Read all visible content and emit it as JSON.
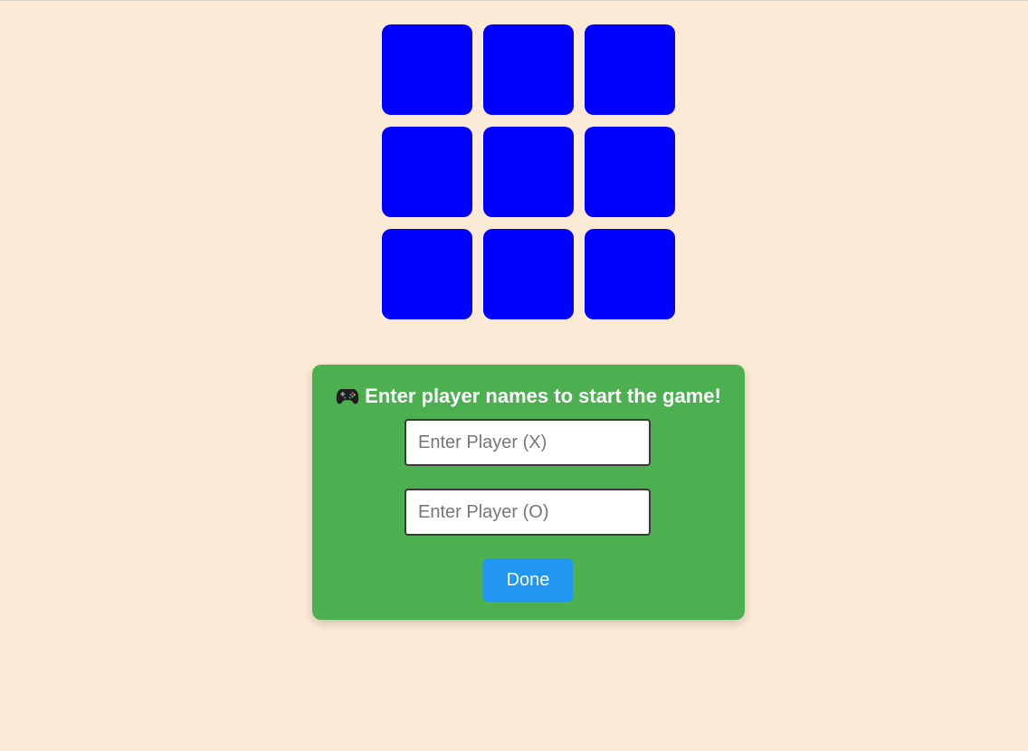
{
  "board": {
    "cells": [
      "",
      "",
      "",
      "",
      "",
      "",
      "",
      "",
      ""
    ],
    "cell_color": "#0000ff"
  },
  "setup": {
    "icon": "game-controller-icon",
    "prompt": "Enter player names to start the game!",
    "player_x": {
      "value": "",
      "placeholder": "Enter Player (X)"
    },
    "player_o": {
      "value": "",
      "placeholder": "Enter Player (O)"
    },
    "done_label": "Done"
  },
  "colors": {
    "background": "#fbead6",
    "panel": "#4caf50",
    "button": "#2196f3",
    "cell": "#0000ff"
  }
}
